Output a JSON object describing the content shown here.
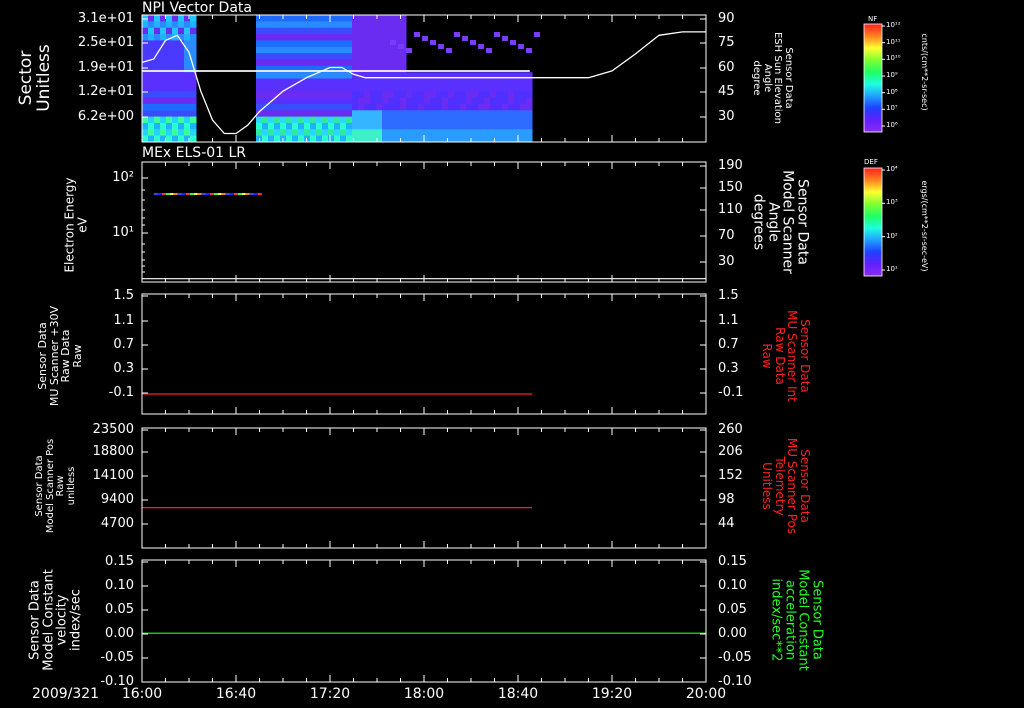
{
  "date_label": "2009/321",
  "x_ticks": [
    "16:00",
    "16:40",
    "17:20",
    "18:00",
    "18:40",
    "19:20",
    "20:00"
  ],
  "colors": {
    "background": "#000000",
    "frame": "#ffffff",
    "red_line": "#ff2020",
    "green_line": "#20ff20",
    "spectrogram_dark": "#6a2cf0"
  },
  "chart_data": [
    {
      "type": "heatmap",
      "title": "NPI Vector Data",
      "ylabel": "Sector\nUnitless",
      "y_tick_labels": [
        "3.1e+01",
        "2.5e+01",
        "1.9e+01",
        "1.2e+01",
        "6.2e+00"
      ],
      "right_ylabel": "Sensor Data\nESH Sun Elevation\nAngle\ndegree",
      "right_y_tick_labels": [
        "90",
        "75",
        "60",
        "45",
        "30"
      ],
      "right_ylim": [
        15,
        90
      ],
      "colorbar": {
        "label": "NF",
        "units": "cnts/(cm**2-sr-sec)",
        "tick_labels": [
          "10¹²",
          "10¹¹",
          "10¹⁰",
          "10⁹",
          "10⁸",
          "10⁷",
          "10⁶"
        ]
      },
      "data_gaps": [
        [
          "16:22",
          "16:48"
        ]
      ],
      "spectrogram_end": "18:45",
      "series": [
        {
          "name": "ESH Sun Elevation Angle",
          "x": [
            "16:00",
            "16:05",
            "16:10",
            "16:15",
            "16:20",
            "16:25",
            "16:30",
            "16:35",
            "16:40",
            "16:45",
            "16:50",
            "17:00",
            "17:10",
            "17:20",
            "17:25",
            "17:30",
            "17:35",
            "17:40",
            "18:00",
            "18:40",
            "19:10",
            "19:20",
            "19:30",
            "19:40",
            "19:50",
            "20:00"
          ],
          "values": [
            62,
            64,
            75,
            78,
            68,
            45,
            28,
            20,
            20,
            25,
            33,
            45,
            53,
            59,
            59,
            55,
            53,
            53,
            53,
            53,
            53,
            57,
            67,
            78,
            80,
            80
          ]
        }
      ]
    },
    {
      "type": "line",
      "title": "MEx ELS-01 LR",
      "ylabel": "Electron Energy\neV",
      "y_tick_labels": [
        "10²",
        "10¹"
      ],
      "right_ylabel": "Sensor Data\nModel Scanner\nAngle\ndegrees",
      "right_y_tick_labels": [
        "190",
        "150",
        "110",
        "70",
        "30"
      ],
      "right_ylim": [
        10,
        190
      ],
      "colorbar": {
        "label": "DEF",
        "units": "ergs/(cm**2-sr-sec-eV)",
        "tick_labels": [
          "10⁴",
          "10³",
          "10²",
          "10¹"
        ]
      },
      "energy_trace": {
        "x": [
          "16:05",
          "16:50"
        ],
        "value": 50
      },
      "series": [
        {
          "name": "Model Scanner Angle",
          "x": [
            "16:00",
            "20:00"
          ],
          "values": [
            15,
            15
          ]
        }
      ]
    },
    {
      "type": "line",
      "ylabel": "Sensor Data\nMU Scanner +30V\nRaw Data\nRaw",
      "y_tick_labels": [
        "1.5",
        "1.1",
        "0.7",
        "0.3",
        "-0.1"
      ],
      "ylim": [
        -0.3,
        1.5
      ],
      "right_ylabel": "Sensor Data\nMU Scanner Int\nRaw Data\nRaw",
      "right_y_tick_labels": [
        "1.5",
        "1.1",
        "0.7",
        "0.3",
        "-0.1"
      ],
      "series": [
        {
          "name": "MU Scanner Int Raw Data",
          "x": [
            "16:00",
            "18:46"
          ],
          "values": [
            0.0,
            0.0
          ]
        }
      ]
    },
    {
      "type": "line",
      "ylabel": "Sensor Data\nModel Scanner Pos\nRaw\nunitless",
      "y_tick_labels": [
        "23500",
        "18800",
        "14100",
        "9400",
        "4700"
      ],
      "ylim": [
        0,
        23500
      ],
      "right_ylabel": "Sensor Data\nMU Scanner Pos\nTelemetry\nUnitless",
      "right_y_tick_labels": [
        "260",
        "206",
        "152",
        "98",
        "44"
      ],
      "series": [
        {
          "name": "MU Scanner Pos Telemetry",
          "x": [
            "16:00",
            "18:46"
          ],
          "values": [
            7900,
            7900
          ]
        }
      ]
    },
    {
      "type": "line",
      "ylabel": "Sensor Data\nModel Constant\nvelocity\nindex/sec",
      "y_tick_labels": [
        "0.15",
        "0.10",
        "0.05",
        "0.00",
        "-0.05",
        "-0.10"
      ],
      "ylim": [
        -0.1,
        0.15
      ],
      "right_ylabel": "Sensor Data\nModel Constant\nacceleration\nindex/sec**2",
      "right_y_tick_labels": [
        "0.15",
        "0.10",
        "0.05",
        "0.00",
        "-0.05",
        "-0.10"
      ],
      "series": [
        {
          "name": "Model Constant acceleration",
          "x": [
            "16:00",
            "20:00"
          ],
          "values": [
            0.0,
            0.0
          ]
        }
      ]
    }
  ]
}
